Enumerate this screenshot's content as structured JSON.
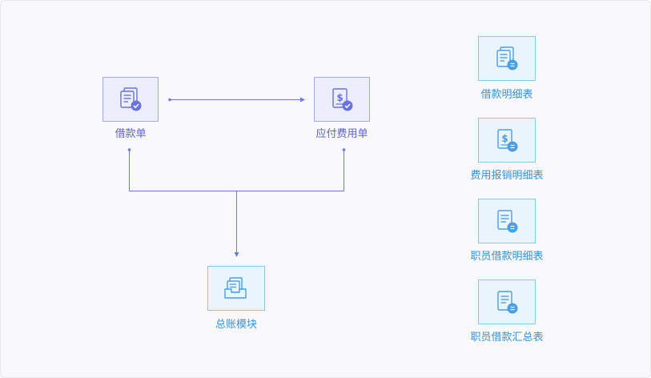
{
  "colors": {
    "purple_accent": "#6a71e0",
    "blue_accent": "#4a9ee6",
    "connector": "#6b7ae6",
    "background": "#f9f9fb"
  },
  "nodes": {
    "loan_form": {
      "label": "借款单",
      "icon": "document-check-icon"
    },
    "payable_expense_form": {
      "label": "应付费用单",
      "icon": "dollar-document-check-icon"
    },
    "general_ledger": {
      "label": "总账模块",
      "icon": "inbox-tray-icon"
    }
  },
  "reports": [
    {
      "label": "借款明细表",
      "icon": "document-badge-icon"
    },
    {
      "label": "费用报销明细表",
      "icon": "dollar-document-badge-icon"
    },
    {
      "label": "职员借款明细表",
      "icon": "document-badge-icon"
    },
    {
      "label": "职员借款汇总表",
      "icon": "document-badge-icon"
    }
  ]
}
